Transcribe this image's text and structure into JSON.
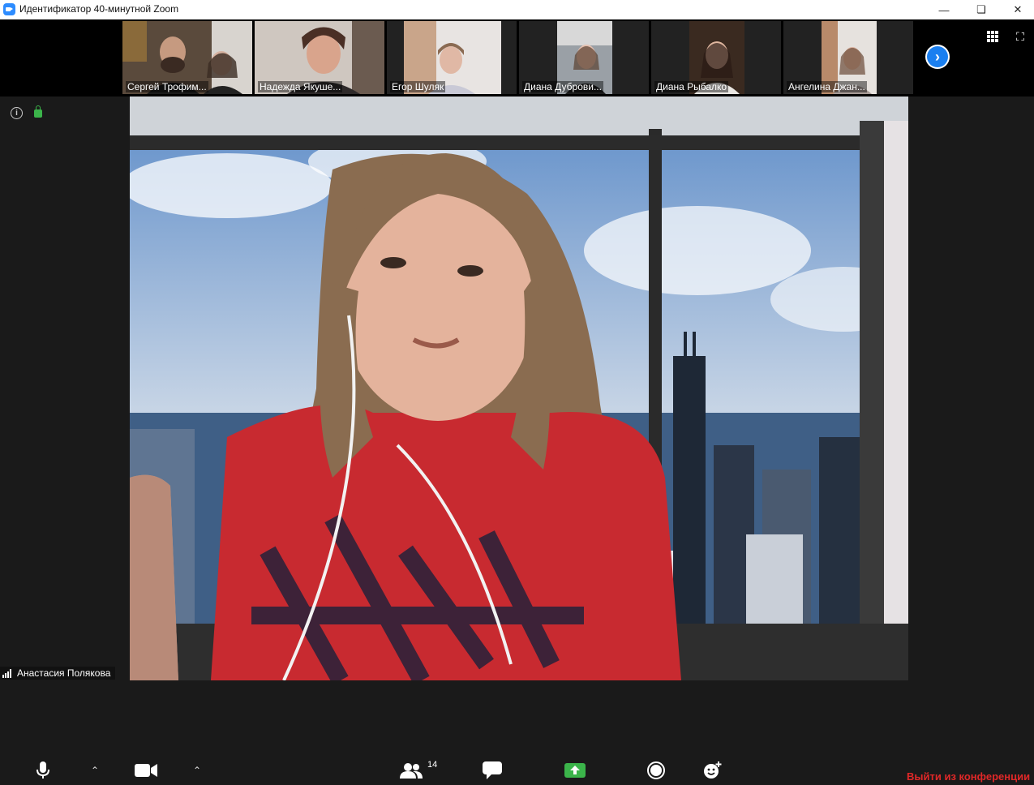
{
  "window": {
    "title": "Идентификатор 40-минутной Zoom"
  },
  "participants": [
    {
      "name": "Сергей Трофим..."
    },
    {
      "name": "Надежда Якуше..."
    },
    {
      "name": "Егор Шуляк"
    },
    {
      "name": "Диана Дуброви..."
    },
    {
      "name": "Диана Рыбалко"
    },
    {
      "name": "Ангелина Джан..."
    }
  ],
  "main": {
    "speaker_name": "Анастасия Полякова"
  },
  "toolbar": {
    "participants_count": "14",
    "leave_label": "Выйти из конференции"
  },
  "colors": {
    "accent": "#2d8cff",
    "leave": "#e02828",
    "share": "#3bb44a"
  },
  "icons": [
    "zoom-icon",
    "minimize-icon",
    "maximize-icon",
    "close-icon",
    "chevron-right-icon",
    "grid-view-icon",
    "fullscreen-icon",
    "info-icon",
    "lock-icon",
    "signal-icon",
    "mic-icon",
    "video-icon",
    "participants-icon",
    "chat-icon",
    "share-screen-icon",
    "record-icon",
    "reactions-icon"
  ]
}
